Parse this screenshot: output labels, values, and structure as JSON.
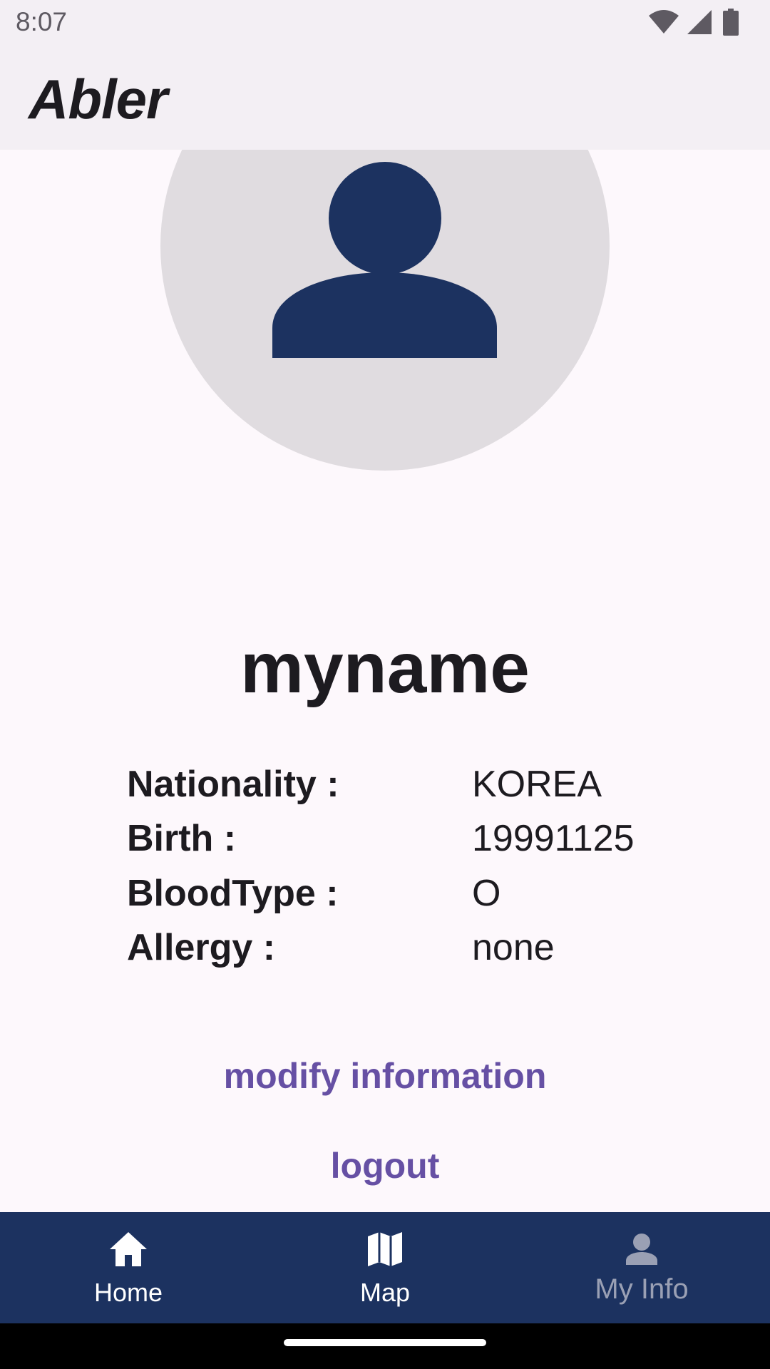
{
  "status_bar": {
    "time": "8:07",
    "icons": [
      "wifi-icon",
      "cell-signal-icon",
      "battery-icon"
    ]
  },
  "app_bar": {
    "title": "Abler"
  },
  "profile": {
    "avatar_icon": "person-icon",
    "name": "myname",
    "fields": [
      {
        "label": "Nationality :",
        "value": "KOREA"
      },
      {
        "label": "Birth :",
        "value": "19991125"
      },
      {
        "label": "BloodType :",
        "value": "O"
      },
      {
        "label": "Allergy :",
        "value": "none"
      }
    ]
  },
  "actions": {
    "modify_label": "modify information",
    "logout_label": "logout"
  },
  "bottom_nav": {
    "items": [
      {
        "label": "Home",
        "icon": "home-icon",
        "selected": false
      },
      {
        "label": "Map",
        "icon": "map-icon",
        "selected": false
      },
      {
        "label": "My Info",
        "icon": "person-icon",
        "selected": true
      }
    ]
  },
  "colors": {
    "app_bar_bg": "#f3eff4",
    "content_bg": "#fdf8fc",
    "avatar_bg": "#e0dce0",
    "avatar_icon": "#1c3260",
    "accent_text": "#6650a4",
    "nav_bg": "#1c3260",
    "nav_active_text": "#ffffff",
    "nav_inactive_text": "#9aa0b4"
  }
}
